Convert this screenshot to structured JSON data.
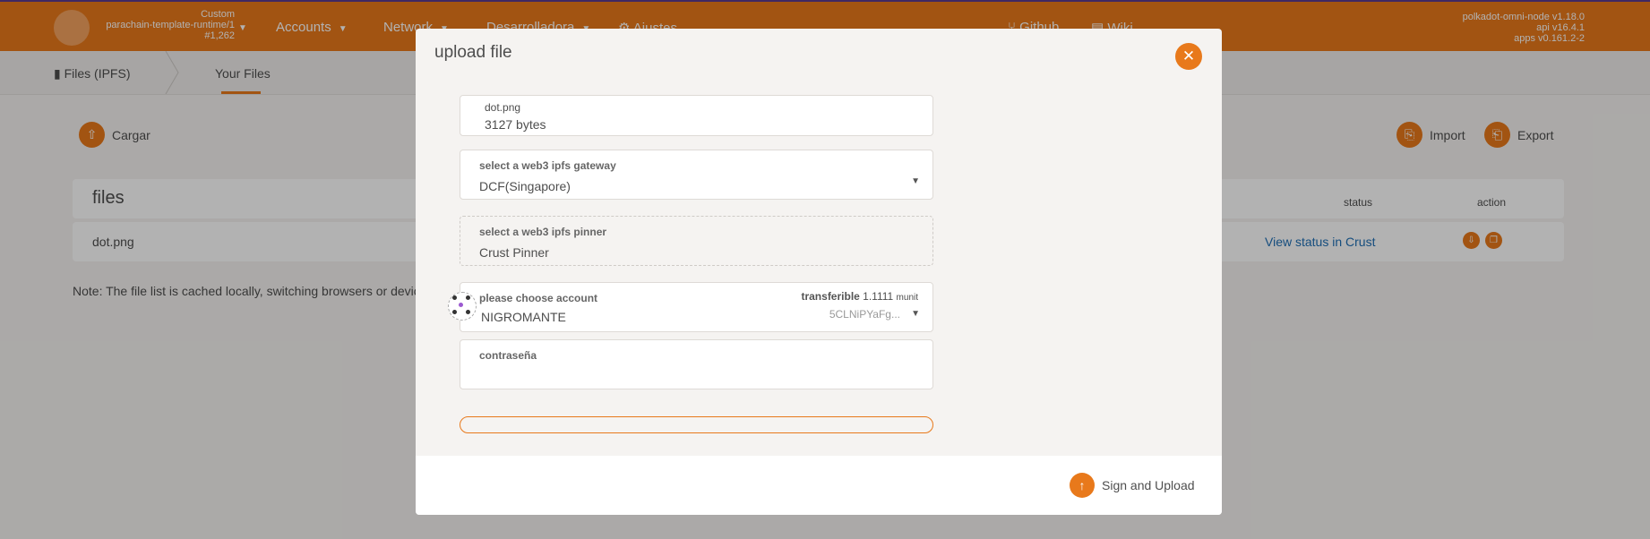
{
  "topbar": {
    "chain": {
      "name": "Custom",
      "runtime": "parachain-template-runtime/1",
      "block": "#1,262"
    },
    "nav": [
      {
        "label": "Accounts"
      },
      {
        "label": "Network"
      },
      {
        "label": "Desarrolladora"
      },
      {
        "label": "Ajustes"
      }
    ],
    "links": [
      {
        "label": "Github"
      },
      {
        "label": "Wiki"
      }
    ],
    "versions": [
      "polkadot-omni-node v1.18.0",
      "api v16.4.1",
      "apps v0.161.2-2"
    ]
  },
  "subnav": {
    "section": "Files (IPFS)",
    "tab": "Your Files"
  },
  "page": {
    "upload_label": "Cargar",
    "import_label": "Import",
    "export_label": "Export",
    "table": {
      "title": "files",
      "col_status": "status",
      "col_action": "action",
      "rows": [
        {
          "name": "dot.png",
          "status": "View status in Crust"
        }
      ]
    },
    "note": "Note: The file list is cached locally, switching browsers or devic"
  },
  "modal": {
    "title": "upload file",
    "file": {
      "name": "dot.png",
      "size": "3127 bytes"
    },
    "gateway": {
      "label": "select a web3 ipfs gateway",
      "value": "DCF(Singapore)"
    },
    "pinner": {
      "label": "select a web3 ipfs pinner",
      "value": "Crust Pinner"
    },
    "account": {
      "label": "please choose account",
      "name": "NIGROMANTE",
      "transferable_label": "transferible",
      "transferable_value": "1.1111",
      "unit": "munit",
      "address": "5CLNiPYaFg..."
    },
    "password": {
      "label": "contraseña",
      "value": ""
    },
    "progress": 0,
    "sign_button": "Sign and Upload"
  },
  "colors": {
    "accent": "#e8791b",
    "link": "#1f6fb5"
  }
}
